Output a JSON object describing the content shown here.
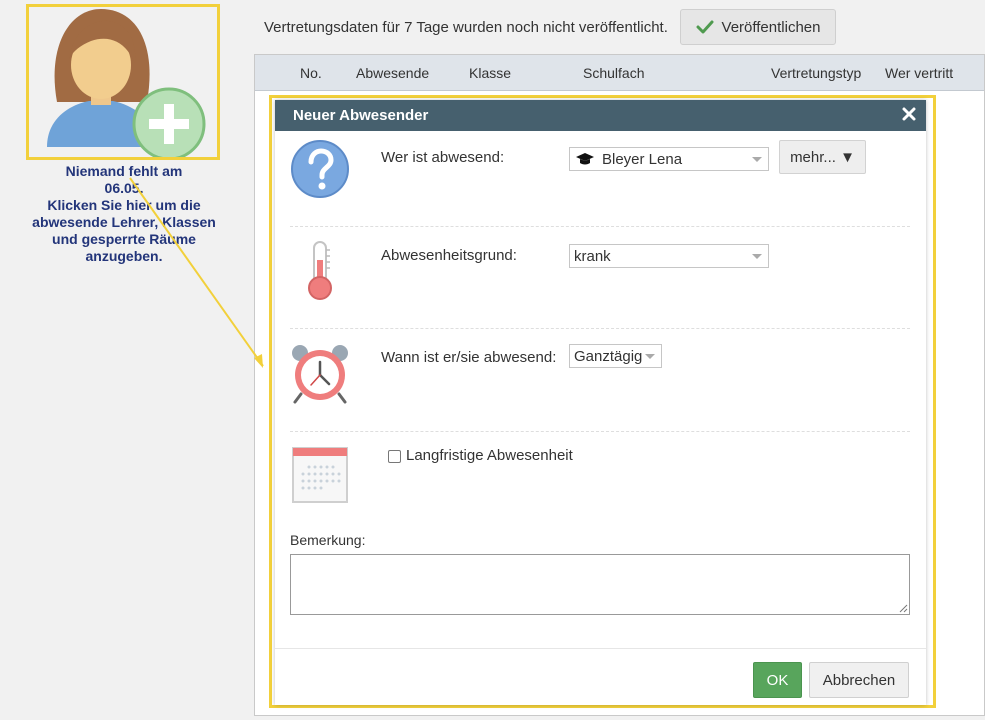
{
  "avatar_panel": {
    "message_lines": [
      "Niemand fehlt am",
      "06.05.",
      "Klicken Sie hier um die",
      "abwesende Lehrer, Klassen",
      "und gesperrte Räume",
      "anzugeben."
    ],
    "icon": "add-person-icon"
  },
  "publish_bar": {
    "text": "Vertretungsdaten für 7 Tage wurden noch nicht veröffentlicht.",
    "button_label": "Veröffentlichen",
    "button_icon": "checkmark-icon"
  },
  "table": {
    "columns": [
      "No.",
      "Abwesende",
      "Klasse",
      "Schulfach",
      "Vertretungstyp",
      "Wer vertritt"
    ]
  },
  "dialog": {
    "title": "Neuer Abwesender",
    "close_icon": "close-icon",
    "who": {
      "label": "Wer ist abwesend:",
      "value": "Bleyer Lena",
      "value_icon": "graduation-cap-icon",
      "more_label": "mehr... ▼",
      "icon": "question-icon"
    },
    "reason": {
      "label": "Abwesenheitsgrund:",
      "value": "krank",
      "icon": "thermometer-icon"
    },
    "when": {
      "label": "Wann ist er/sie abwesend:",
      "value": "Ganztägig",
      "icon": "alarm-clock-icon"
    },
    "longterm": {
      "label": "Langfristige Abwesenheit",
      "checked": false,
      "icon": "calendar-icon"
    },
    "remark": {
      "label": "Bemerkung:",
      "value": ""
    },
    "ok_label": "OK",
    "cancel_label": "Abbrechen"
  },
  "colors": {
    "highlight": "#f2d03b",
    "dialog_title_bg": "#46606e",
    "ok_green": "#58a55c",
    "message_text": "#23357a"
  }
}
